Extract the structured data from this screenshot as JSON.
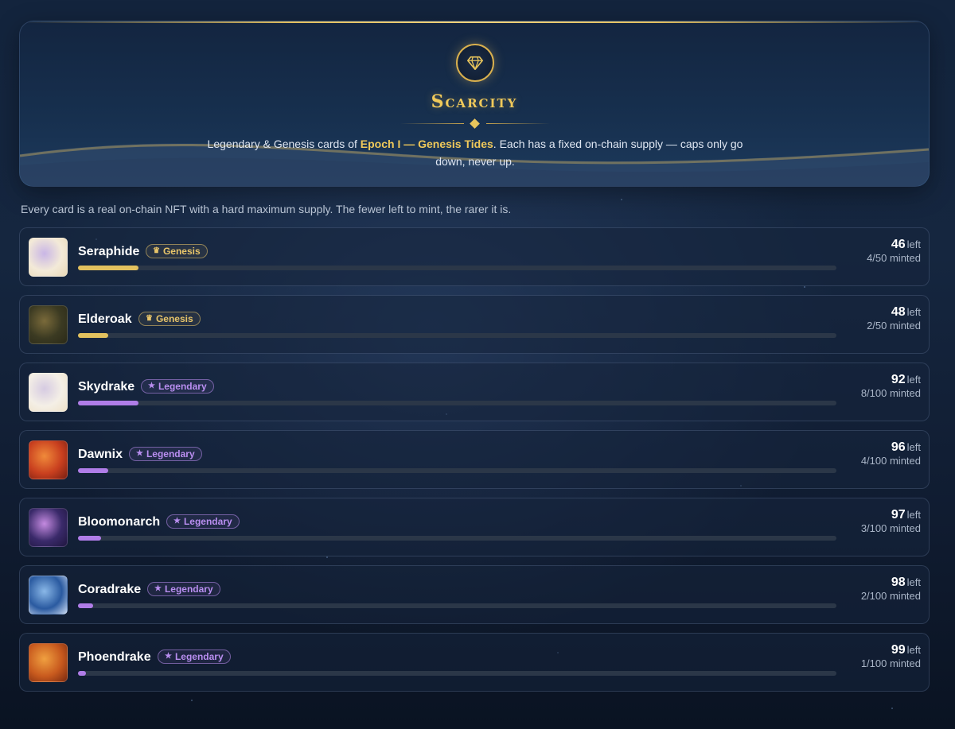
{
  "hero": {
    "title": "Scarcity",
    "desc_prefix": "Legendary & Genesis cards of ",
    "desc_highlight": "Epoch I — Genesis Tides",
    "desc_suffix": ". Each has a fixed on-chain supply — caps only go down, never up.",
    "icon": "gem-icon"
  },
  "intro": "Every card is a real on-chain NFT with a hard maximum supply. The fewer left to mint, the rarer it is.",
  "left_word": "left",
  "colors": {
    "genesis": "#e2c15e",
    "legendary": "#b07de8",
    "title_gold": "#f0c95a"
  },
  "cards": [
    {
      "name": "Seraphide",
      "rarity": "genesis",
      "badge": "Genesis",
      "badge_icon": "♛",
      "left": "46",
      "minted_text": "4/50 minted",
      "minted": 4,
      "cap": 50,
      "thumb": [
        "#f3ead8",
        "#c9b6e6",
        "#e8d9b8"
      ]
    },
    {
      "name": "Elderoak",
      "rarity": "genesis",
      "badge": "Genesis",
      "badge_icon": "♛",
      "left": "48",
      "minted_text": "2/50 minted",
      "minted": 2,
      "cap": 50,
      "thumb": [
        "#3b3a22",
        "#7a6a3a",
        "#2b2a18"
      ]
    },
    {
      "name": "Skydrake",
      "rarity": "legendary",
      "badge": "Legendary",
      "badge_icon": "★",
      "left": "92",
      "minted_text": "8/100 minted",
      "minted": 8,
      "cap": 100,
      "thumb": [
        "#f4efe6",
        "#d6cbe2",
        "#efe2c9"
      ]
    },
    {
      "name": "Dawnix",
      "rarity": "legendary",
      "badge": "Legendary",
      "badge_icon": "★",
      "left": "96",
      "minted_text": "4/100 minted",
      "minted": 4,
      "cap": 100,
      "thumb": [
        "#c9401f",
        "#f08a3a",
        "#7a1f12"
      ]
    },
    {
      "name": "Bloomonarch",
      "rarity": "legendary",
      "badge": "Legendary",
      "badge_icon": "★",
      "left": "97",
      "minted_text": "3/100 minted",
      "minted": 3,
      "cap": 100,
      "thumb": [
        "#3a2a6a",
        "#c48ae0",
        "#1f1640"
      ]
    },
    {
      "name": "Coradrake",
      "rarity": "legendary",
      "badge": "Legendary",
      "badge_icon": "★",
      "left": "98",
      "minted_text": "2/100 minted",
      "minted": 2,
      "cap": 100,
      "thumb": [
        "#2a5aa0",
        "#8ab8e8",
        "#c8d8f0"
      ]
    },
    {
      "name": "Phoendrake",
      "rarity": "legendary",
      "badge": "Legendary",
      "badge_icon": "★",
      "left": "99",
      "minted_text": "1/100 minted",
      "minted": 1,
      "cap": 100,
      "thumb": [
        "#c85a1e",
        "#f0a040",
        "#7a2a10"
      ]
    }
  ]
}
